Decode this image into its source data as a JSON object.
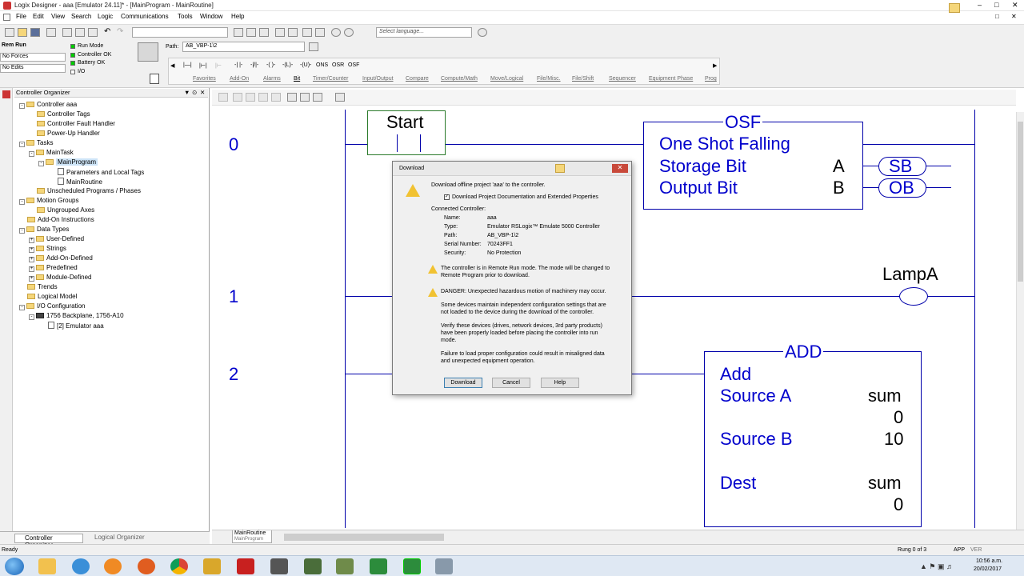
{
  "window": {
    "title": "Logix Designer - aaa [Emulator 24.11]* - [MainProgram - MainRoutine]"
  },
  "menu": [
    "File",
    "Edit",
    "View",
    "Search",
    "Logic",
    "Communications",
    "Tools",
    "Window",
    "Help"
  ],
  "toolbar": {
    "language_placeholder": "Select language...",
    "path_label": "Path:",
    "path_value": "AB_VBP-1\\2"
  },
  "controller_status": {
    "mode": "Rem Run",
    "forces": "No Forces",
    "edits": "No Edits",
    "run_mode": "Run Mode",
    "controller_ok": "Controller OK",
    "battery_ok": "Battery OK",
    "io": "I/O"
  },
  "instructions": {
    "items": [
      "OSR",
      "OSF",
      "ONS"
    ],
    "tabs": [
      "Favorites",
      "Add-On",
      "Alarms",
      "Bit",
      "Timer/Counter",
      "Input/Output",
      "Compare",
      "Compute/Math",
      "Move/Logical",
      "File/Misc.",
      "File/Shift",
      "Sequencer",
      "Equipment Phase",
      "Prog"
    ]
  },
  "organizer": {
    "title": "Controller Organizer",
    "tree": [
      "Controller aaa",
      "Controller Tags",
      "Controller Fault Handler",
      "Power-Up Handler",
      "Tasks",
      "MainTask",
      "MainProgram",
      "Parameters and Local Tags",
      "MainRoutine",
      "Unscheduled Programs / Phases",
      "Motion Groups",
      "Ungrouped Axes",
      "Add-On Instructions",
      "Data Types",
      "User-Defined",
      "Strings",
      "Add-On-Defined",
      "Predefined",
      "Module-Defined",
      "Trends",
      "Logical Model",
      "I/O Configuration",
      "1756 Backplane, 1756-A10",
      "[2] Emulator aaa"
    ],
    "tabs": [
      "Controller Organizer",
      "Logical Organizer"
    ]
  },
  "ladder": {
    "rungs": [
      "0",
      "1",
      "2"
    ],
    "start_tag": "Start",
    "osf": {
      "title": "OSF",
      "name": "One Shot Falling",
      "storage_label": "Storage Bit",
      "storage_value": "A",
      "output_label": "Output Bit",
      "output_value": "B",
      "sb": "SB",
      "ob": "OB"
    },
    "lamp_tag": "LampA",
    "add": {
      "title": "ADD",
      "name": "Add",
      "src_a": "Source A",
      "src_a_tag": "sum",
      "src_a_val": "0",
      "src_b": "Source B",
      "src_b_val": "10",
      "dest": "Dest",
      "dest_tag": "sum",
      "dest_val": "0"
    },
    "tab_label": "MainRoutine",
    "tab_sub": "MainProgram"
  },
  "dialog": {
    "title": "Download",
    "intro": "Download offline project 'aaa' to the controller.",
    "checkbox": "Download Project Documentation and Extended Properties",
    "connected": "Connected Controller:",
    "fields": [
      {
        "k": "Name:",
        "v": "aaa"
      },
      {
        "k": "Type:",
        "v": "Emulator RSLogix™ Emulate 5000 Controller"
      },
      {
        "k": "Path:",
        "v": "AB_VBP-1\\2"
      },
      {
        "k": "Serial Number:",
        "v": "70243FF1"
      },
      {
        "k": "Security:",
        "v": "No Protection"
      }
    ],
    "warn1a": "The controller is in Remote Run mode. The mode will be changed to",
    "warn1b": "Remote Program prior to download.",
    "warn2": "DANGER: Unexpected hazardous motion of machinery may occur.",
    "p1a": "Some devices maintain independent configuration settings that are",
    "p1b": "not loaded to the device during the download of the controller.",
    "p2a": "Verify these devices (drives, network devices, 3rd party products)",
    "p2b": "have been properly loaded before placing the controller into run",
    "p2c": "mode.",
    "p3a": "Failure to load proper configuration could result in misaligned data",
    "p3b": "and unexpected equipment operation.",
    "buttons": [
      "Download",
      "Cancel",
      "Help"
    ]
  },
  "statusbar": {
    "left": "Ready",
    "rung": "Rung 0 of 3",
    "app": "APP",
    "ver": "VER"
  },
  "taskbar": {
    "time": "10:56 a.m.",
    "date": "20/02/2017"
  }
}
